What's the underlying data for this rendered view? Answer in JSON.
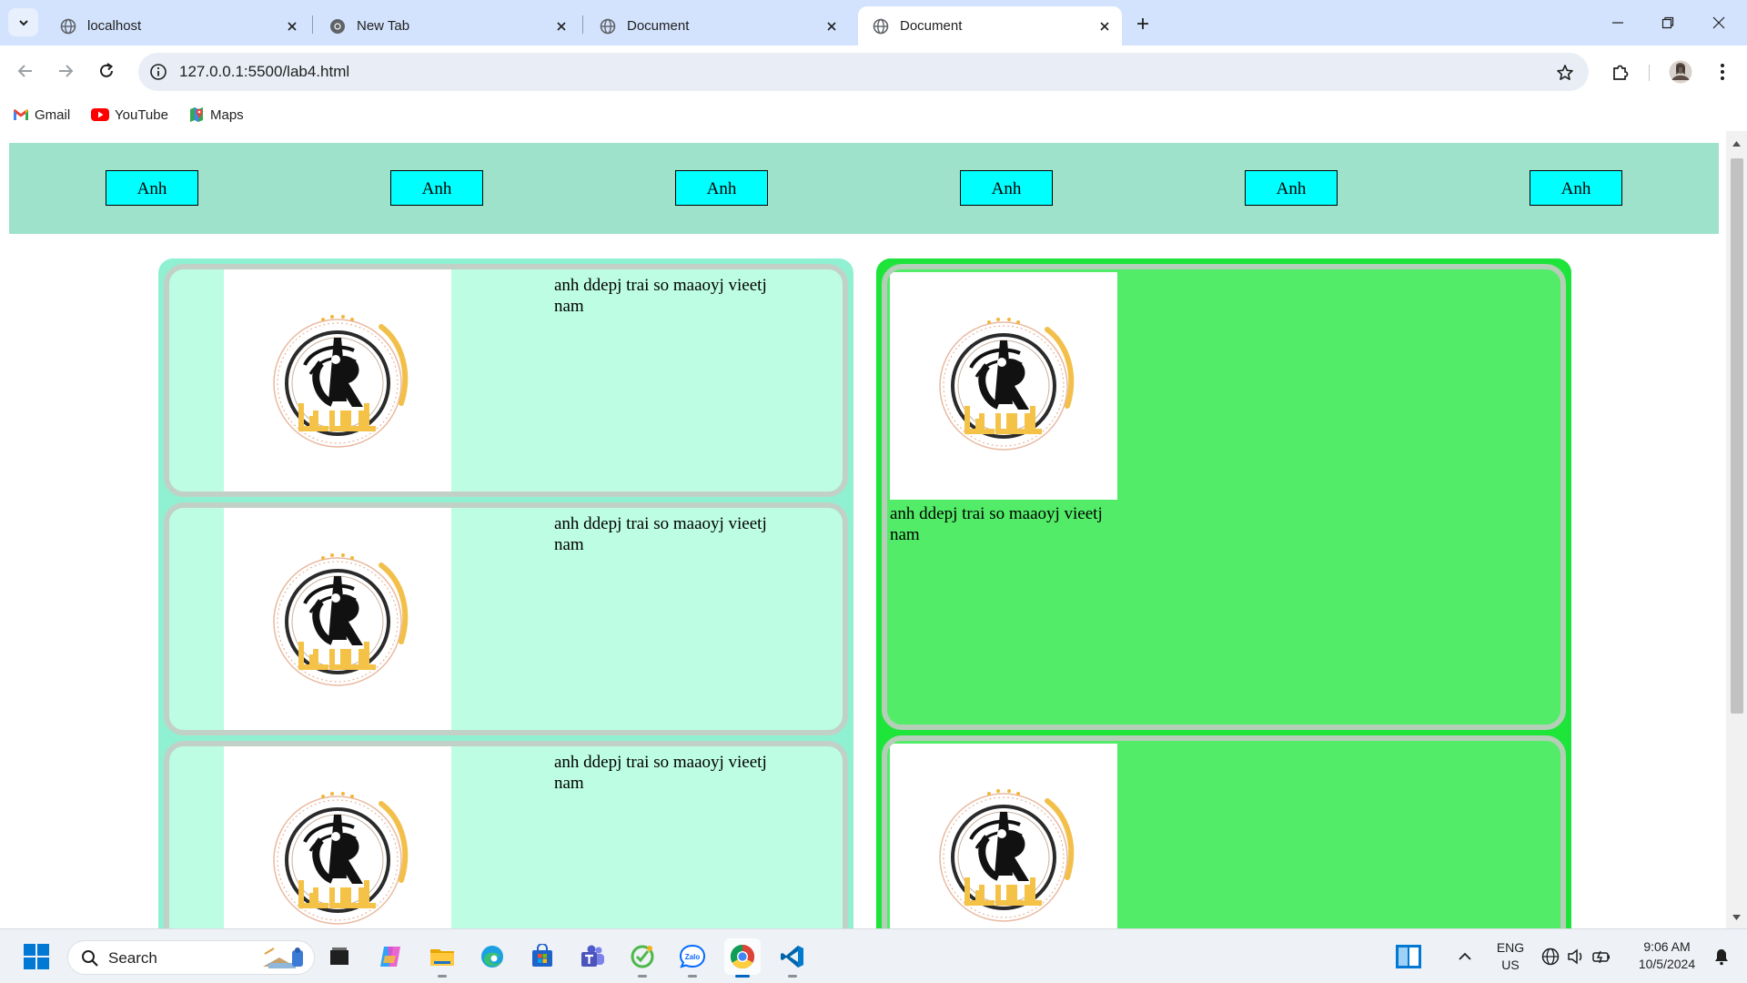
{
  "browser": {
    "tabs": [
      {
        "title": "localhost",
        "favicon": "globe-icon",
        "active": false
      },
      {
        "title": "New Tab",
        "favicon": "chrome-icon",
        "active": false
      },
      {
        "title": "Document",
        "favicon": "globe-icon",
        "active": false
      },
      {
        "title": "Document",
        "favicon": "globe-icon",
        "active": true
      }
    ],
    "address": "127.0.0.1:5500/lab4.html",
    "bookmarks": [
      {
        "label": "Gmail",
        "icon": "gmail-icon"
      },
      {
        "label": "YouTube",
        "icon": "youtube-icon"
      },
      {
        "label": "Maps",
        "icon": "maps-icon"
      }
    ]
  },
  "page": {
    "nav_buttons": [
      "Anh",
      "Anh",
      "Anh",
      "Anh",
      "Anh",
      "Anh"
    ],
    "left_cards": [
      {
        "text": "anh ddepj trai so maaoyj vieetj nam",
        "image": "university-logo"
      },
      {
        "text": "anh ddepj trai so maaoyj vieetj nam",
        "image": "university-logo"
      },
      {
        "text": "anh ddepj trai so maaoyj vieetj nam",
        "image": "university-logo"
      }
    ],
    "right_cards": [
      {
        "text": "anh ddepj trai so maaoyj vieetj nam",
        "image": "university-logo"
      },
      {
        "text": "",
        "image": "university-logo"
      }
    ],
    "colors": {
      "nav_bg": "#9ee2cb",
      "button_bg": "#00ffff",
      "left_column_bg": "#8ff0d2",
      "left_card_bg": "#bdfde4",
      "right_column_bg": "#1de53a",
      "right_card_bg": "#52ec68"
    }
  },
  "taskbar": {
    "search_placeholder": "Search",
    "apps": [
      "widgets-icon",
      "file-explorer-icon",
      "copilot-icon",
      "folder-icon",
      "edge-icon",
      "store-icon",
      "teams-icon",
      "qbittorrent-icon",
      "zalo-icon",
      "chrome-icon",
      "vscode-icon"
    ],
    "language": "ENG",
    "region": "US",
    "time": "9:06 AM",
    "date": "10/5/2024"
  }
}
